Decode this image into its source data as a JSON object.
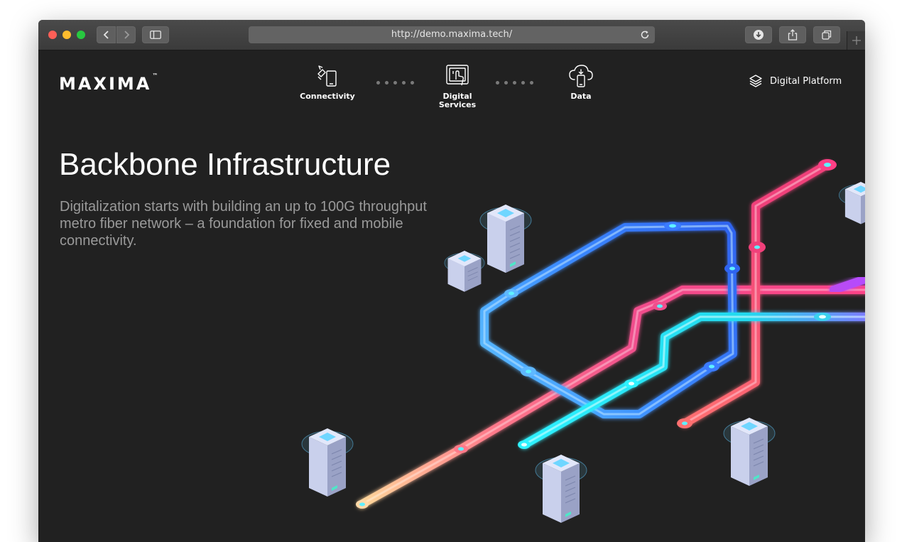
{
  "browser": {
    "url": "http://demo.maxima.tech/"
  },
  "header": {
    "logo_text": "MAXIMA",
    "logo_mark": "™",
    "nav": [
      {
        "label": "Connectivity",
        "icon": "connectivity-icon"
      },
      {
        "label_line1": "Digital",
        "label_line2": "Services",
        "icon": "digital-services-icon"
      },
      {
        "label": "Data",
        "icon": "cloud-data-icon"
      }
    ],
    "platform_label": "Digital Platform",
    "platform_icon": "layers-icon"
  },
  "hero": {
    "title": "Backbone Infrastructure",
    "description": "Digitalization starts with building an up to 100G throughput metro fiber network – a foundation for fixed and mobile connectivity."
  },
  "colors": {
    "background": "#212121",
    "fiber_blue": "#3b7bff",
    "fiber_pink": "#f04e8c",
    "fiber_cyan": "#27e6f2",
    "fiber_violet": "#c24fd6"
  }
}
